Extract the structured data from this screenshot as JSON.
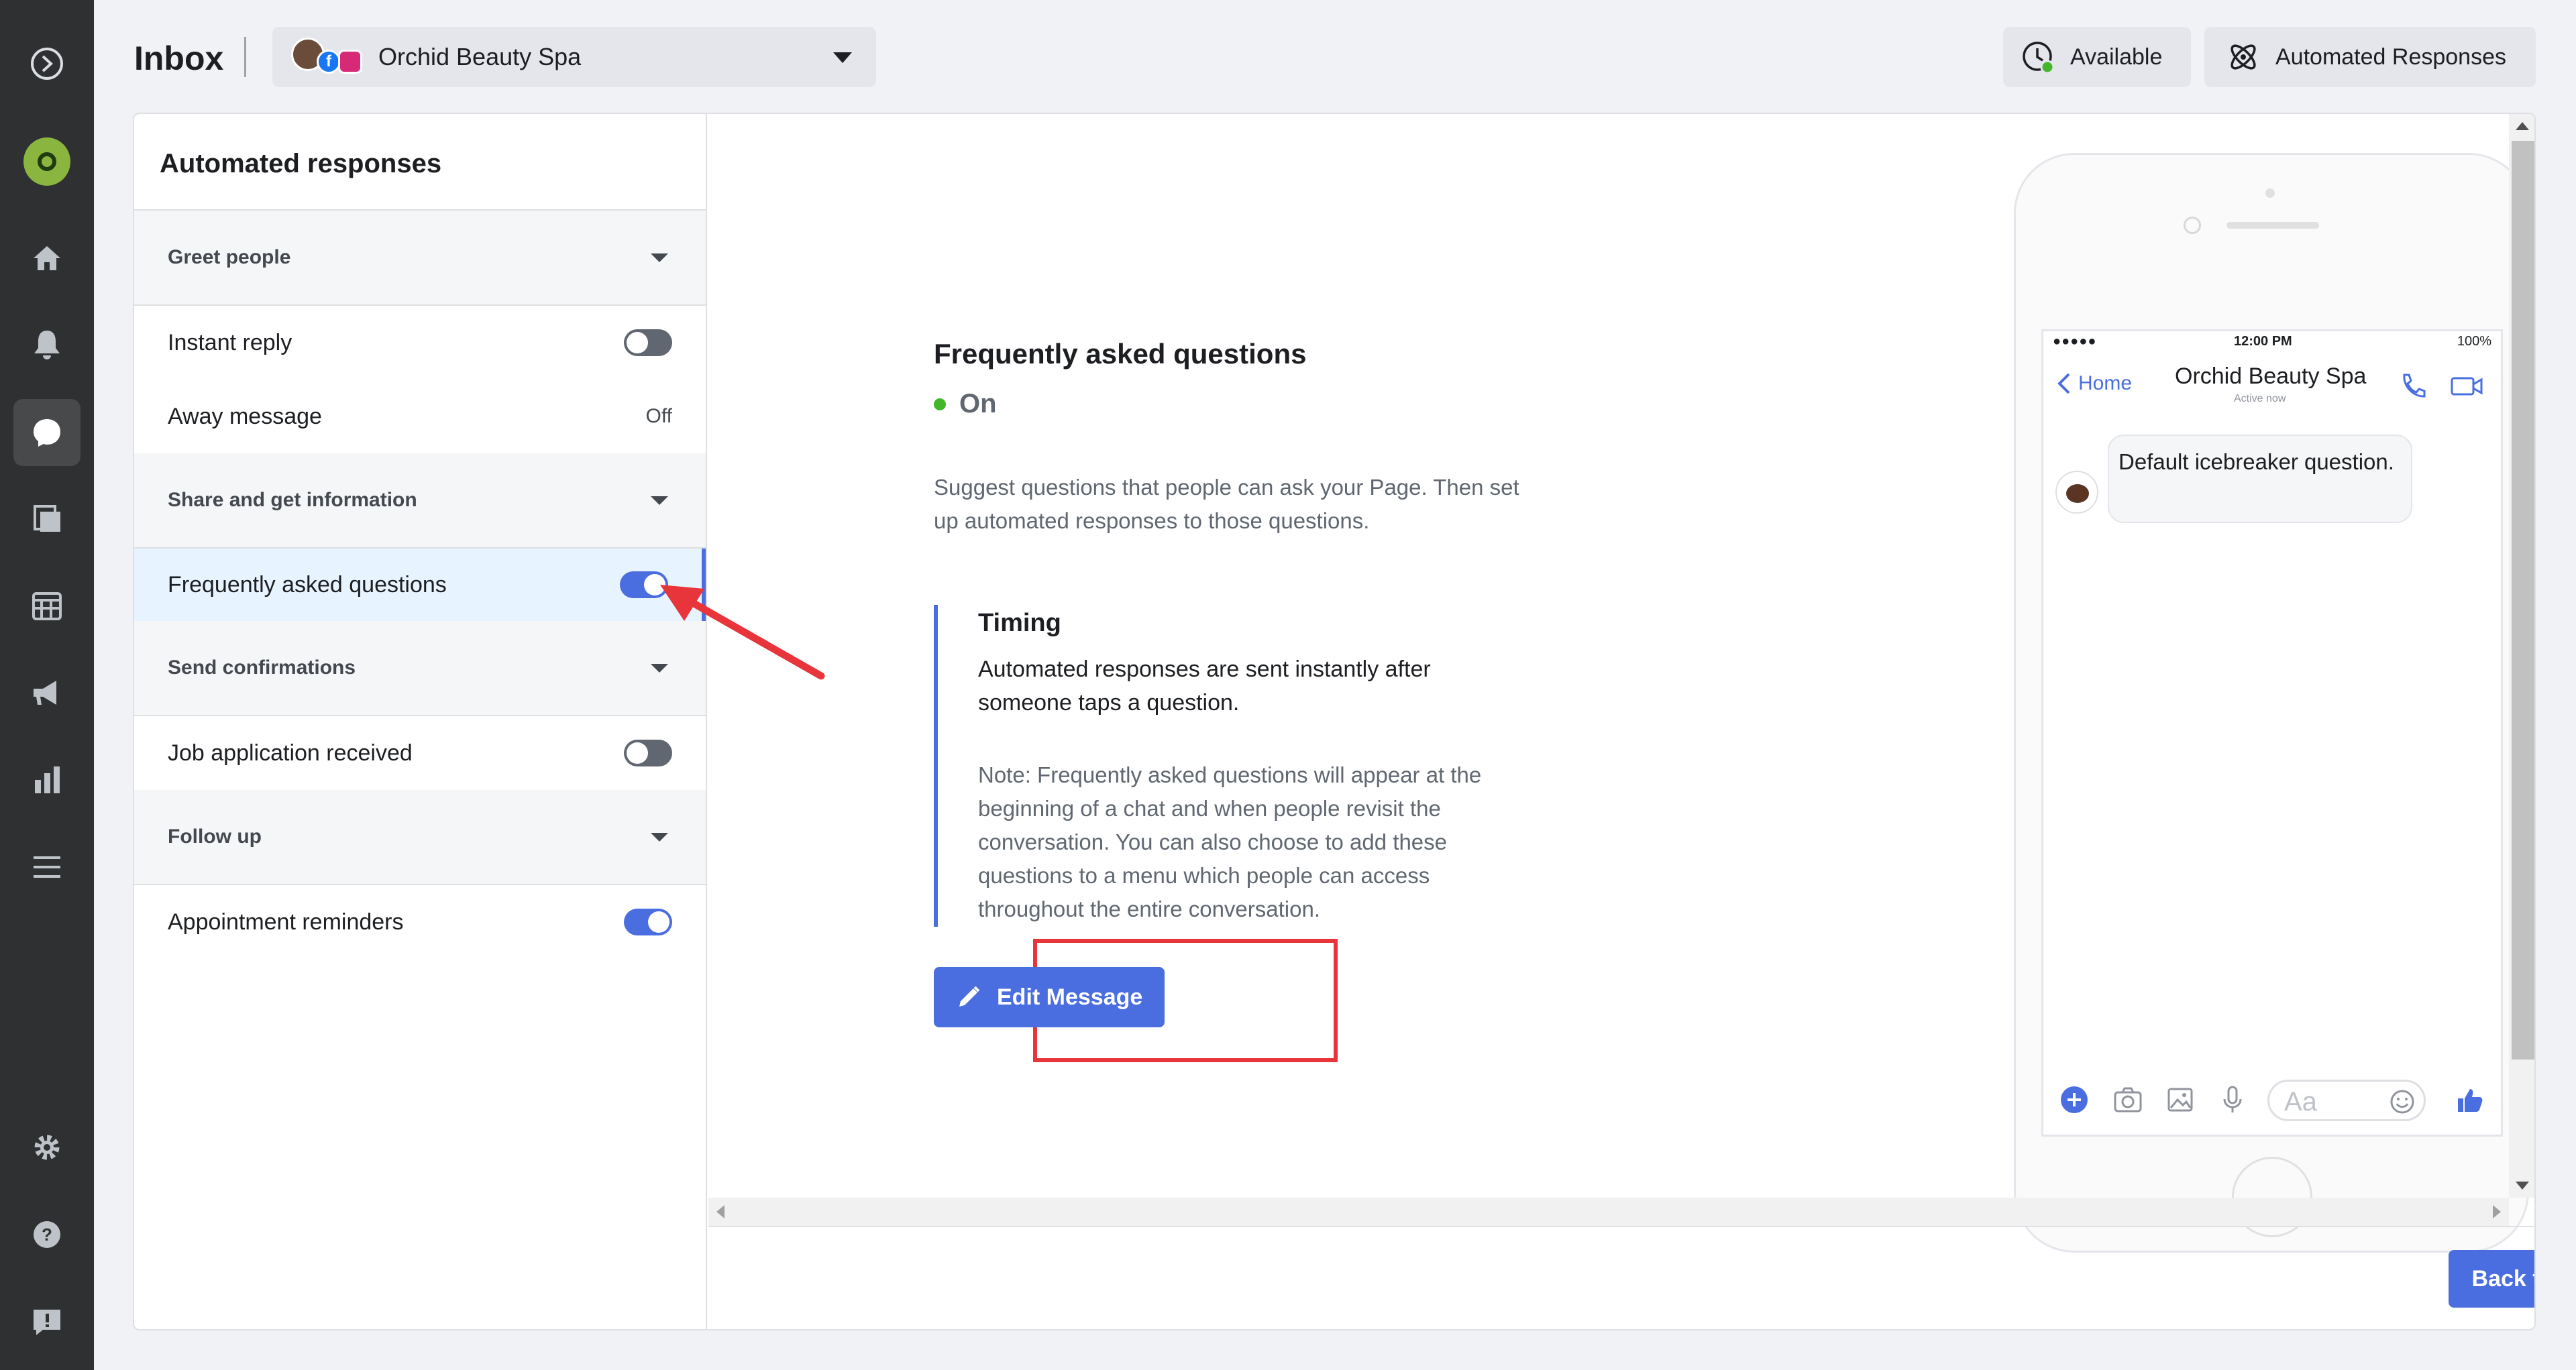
{
  "topbar": {
    "title": "Inbox",
    "page_name": "Orchid Beauty Spa",
    "available_label": "Available",
    "automated_responses_label": "Automated Responses"
  },
  "sidebar_icons": [
    "logo-icon",
    "profile-avatar",
    "home-icon",
    "bell-icon",
    "chat-icon",
    "pages-icon",
    "calendar-icon",
    "megaphone-icon",
    "insights-icon",
    "menu-icon",
    "gear-icon",
    "help-icon",
    "report-icon"
  ],
  "left_panel": {
    "title": "Automated responses",
    "sections": [
      {
        "label": "Greet people",
        "items": [
          {
            "label": "Instant reply",
            "state": "off-toggle"
          },
          {
            "label": "Away message",
            "state": "Off"
          }
        ]
      },
      {
        "label": "Share and get information",
        "items": [
          {
            "label": "Frequently asked questions",
            "state": "on-toggle"
          }
        ]
      },
      {
        "label": "Send confirmations",
        "items": [
          {
            "label": "Job application received",
            "state": "off-toggle"
          }
        ]
      },
      {
        "label": "Follow up",
        "items": [
          {
            "label": "Appointment reminders",
            "state": "on-toggle"
          }
        ]
      }
    ]
  },
  "detail": {
    "title": "Frequently asked questions",
    "status": "On",
    "description": "Suggest questions that people can ask your Page. Then set up automated responses to those questions.",
    "timing_title": "Timing",
    "timing_text": "Automated responses are sent instantly after someone taps a question.",
    "timing_note": "Note: Frequently asked questions will appear at the beginning of a chat and when people revisit the conversation. You can also choose to add these questions to a menu which people can access throughout the entire conversation.",
    "edit_button": "Edit Message"
  },
  "phone_preview": {
    "signal": "●●●●● ",
    "time": "12:00 PM",
    "battery": "100%",
    "back_label": "Home",
    "contact_name": "Orchid Beauty Spa",
    "contact_status": "Active now",
    "message": "Default icebreaker question.",
    "composer_placeholder": "Aa"
  },
  "footer": {
    "back_button": "Back to inbox"
  },
  "colors": {
    "accent": "#4a6ee0",
    "status_on": "#42b72a",
    "annotation": "#e8353b",
    "rail": "#2f3031"
  }
}
